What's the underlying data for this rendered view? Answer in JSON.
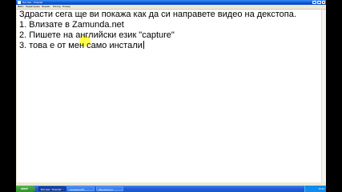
{
  "window": {
    "title": "Без име - Notepad"
  },
  "menu": [
    "Файл",
    "Редактиране",
    "Формат",
    "Изглед",
    "Помощ"
  ],
  "document": {
    "lines": [
      "Здрасти сега ще ви покажа как да си направете видео на декстопа.",
      "1. Влизате в Zamunda.net",
      "2. Пишете на английски език \"capture\"",
      "3. това е от мен само инстали"
    ]
  },
  "taskbar": {
    "start_label": "start",
    "tasks": [
      "Без име - Notepad",
      "Camtasia MP...",
      "Zamunda.net"
    ],
    "clock": "15:24"
  },
  "colors": {
    "accent": "#245edb",
    "highlight": "#ffff2a"
  }
}
